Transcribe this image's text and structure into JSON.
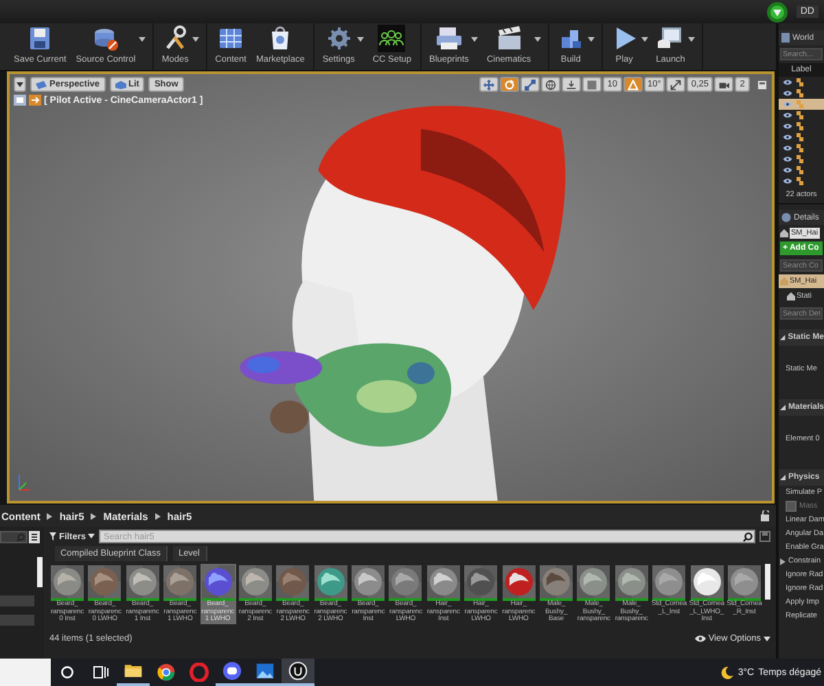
{
  "title_bar": {
    "account_label": "DD"
  },
  "toolbar": {
    "groups": [
      [
        {
          "label": "Save Current",
          "menu": false
        },
        {
          "label": "Source Control",
          "menu": true
        }
      ],
      [
        {
          "label": "Modes",
          "menu": true
        }
      ],
      [
        {
          "label": "Content",
          "menu": false
        },
        {
          "label": "Marketplace",
          "menu": false
        }
      ],
      [
        {
          "label": "Settings",
          "menu": true
        },
        {
          "label": "CC Setup",
          "menu": false
        }
      ],
      [
        {
          "label": "Blueprints",
          "menu": true
        },
        {
          "label": "Cinematics",
          "menu": true
        }
      ],
      [
        {
          "label": "Build",
          "menu": true
        }
      ],
      [
        {
          "label": "Play",
          "menu": true
        },
        {
          "label": "Launch",
          "menu": true
        }
      ]
    ]
  },
  "viewport": {
    "view_buttons": [
      {
        "label": "Perspective"
      },
      {
        "label": "Lit"
      },
      {
        "label": "Show"
      }
    ],
    "tools": [
      {
        "kind": "icon",
        "active": false
      },
      {
        "kind": "icon",
        "active": true
      },
      {
        "kind": "icon",
        "active": false
      },
      {
        "kind": "icon",
        "active": false
      },
      {
        "kind": "icon",
        "active": false
      },
      {
        "kind": "icon",
        "active": false
      },
      {
        "kind": "value",
        "text": "10"
      },
      {
        "kind": "icon",
        "active": true
      },
      {
        "kind": "value",
        "text": "10°"
      },
      {
        "kind": "icon",
        "active": false
      },
      {
        "kind": "value",
        "text": "0,25"
      },
      {
        "kind": "icon",
        "active": false
      },
      {
        "kind": "value",
        "text": "2"
      }
    ],
    "pilot_label": "[ Pilot Active - CineCameraActor1 ]"
  },
  "content_browser": {
    "path": [
      "Content",
      "hair5",
      "Materials",
      "hair5"
    ],
    "filters_label": "Filters",
    "search": {
      "placeholder": "Search hair5"
    },
    "chips": [
      "Compiled Blueprint Class",
      "Level"
    ],
    "assets": [
      {
        "label": "Beard_\nransparenc\n0 Inst",
        "selected": false
      },
      {
        "label": "Beard_\nransparenc\n0 LWHO",
        "selected": false
      },
      {
        "label": "Beard_\nransparenc\n1 Inst",
        "selected": false
      },
      {
        "label": "Beard_\nransparenc\n1 LWHO",
        "selected": false
      },
      {
        "label": "Beard_\nransparenc\n1 LWHO",
        "selected": true
      },
      {
        "label": "Beard_\nransparenc\n2 Inst",
        "selected": false
      },
      {
        "label": "Beard_\nransparenc\n2 LWHO",
        "selected": false
      },
      {
        "label": "Beard_\nransparenc\n2 LWHO",
        "selected": false
      },
      {
        "label": "Beard_\nransparenc\nInst",
        "selected": false
      },
      {
        "label": "Beard_\nransparenc\nLWHO",
        "selected": false
      },
      {
        "label": "Hair_\nransparenc\nInst",
        "selected": false
      },
      {
        "label": "Hair_\nransparenc\nLWHO",
        "selected": false
      },
      {
        "label": "Hair_\nransparenc\nLWHO",
        "selected": false
      },
      {
        "label": "Male_\nBushy_\nBase",
        "selected": false
      },
      {
        "label": "Male_\nBushy_\nransparenc",
        "selected": false
      },
      {
        "label": "Male_\nBushy_\nransparenc",
        "selected": false
      },
      {
        "label": "Std_Cornea\n_L_Inst",
        "selected": false
      },
      {
        "label": "Std_Cornea\n_L_LWHO_\nInst",
        "selected": false
      },
      {
        "label": "Std_Cornea\n_R_Inst",
        "selected": false
      }
    ],
    "status": "44 items (1 selected)",
    "view_options": "View Options"
  },
  "world_outliner": {
    "title": "World",
    "search": {
      "placeholder": "Search..."
    },
    "column": "Label",
    "rows": [
      {
        "selected": false
      },
      {
        "selected": false
      },
      {
        "selected": true
      },
      {
        "selected": false
      },
      {
        "selected": false
      },
      {
        "selected": false
      },
      {
        "selected": false
      },
      {
        "selected": false
      },
      {
        "selected": false
      },
      {
        "selected": false
      }
    ],
    "count": "22 actors"
  },
  "details": {
    "title": "Details",
    "items": [
      {
        "kind": "field",
        "text": "SM_Hai"
      },
      {
        "kind": "button",
        "text": "+ Add Co"
      },
      {
        "kind": "search",
        "placeholder": "Search Co"
      },
      {
        "kind": "component",
        "text": "SM_Hai",
        "selected": true
      },
      {
        "kind": "subcomponent",
        "text": "Stati",
        "selected": false
      },
      {
        "kind": "search",
        "placeholder": "Search Det"
      },
      {
        "kind": "section",
        "text": "Static Me"
      },
      {
        "kind": "asset_property",
        "text": "Static Me"
      },
      {
        "kind": "section",
        "text": "Materials"
      },
      {
        "kind": "asset_property",
        "text": "Element 0"
      },
      {
        "kind": "section",
        "text": "Physics"
      },
      {
        "kind": "property",
        "text": "Simulate P"
      },
      {
        "kind": "checkbox",
        "text": "Mass",
        "checked": false
      },
      {
        "kind": "property",
        "text": "Linear Dam"
      },
      {
        "kind": "property",
        "text": "Angular Da"
      },
      {
        "kind": "property",
        "text": "Enable Gra"
      },
      {
        "kind": "group",
        "text": "Constrain"
      },
      {
        "kind": "property",
        "text": "Ignore Rad"
      },
      {
        "kind": "property",
        "text": "Ignore Rad"
      },
      {
        "kind": "property",
        "text": "Apply Imp"
      },
      {
        "kind": "property",
        "text": "Replicate"
      }
    ]
  },
  "taskbar": {
    "apps": [
      {
        "running": true,
        "active": false
      },
      {
        "running": false,
        "active": false
      },
      {
        "running": false,
        "active": false
      },
      {
        "running": true,
        "active": false
      },
      {
        "running": true,
        "active": false
      },
      {
        "running": true,
        "active": true
      }
    ],
    "weather": {
      "temperature": "3°C",
      "condition": "Temps dégagé"
    }
  }
}
